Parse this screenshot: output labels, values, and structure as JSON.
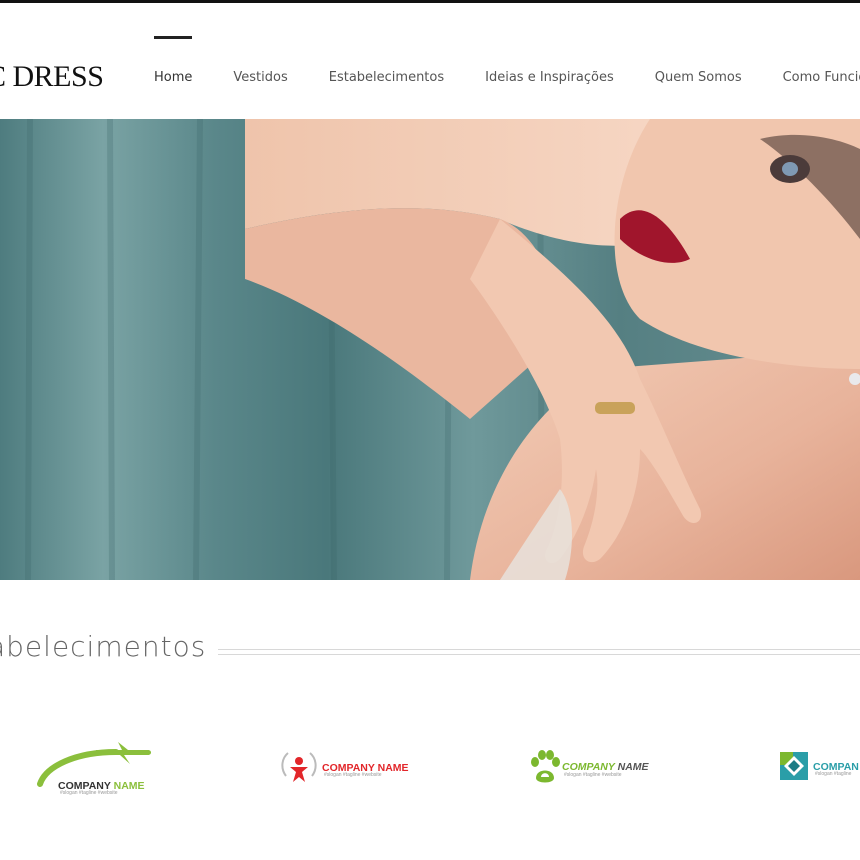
{
  "brand": {
    "logo_text": "C DRESS"
  },
  "nav": {
    "items": [
      {
        "label": "Home",
        "active": true
      },
      {
        "label": "Vestidos"
      },
      {
        "label": "Estabelecimentos"
      },
      {
        "label": "Ideias e Inspirações"
      },
      {
        "label": "Quem Somos"
      },
      {
        "label": "Como Funcior"
      }
    ]
  },
  "section": {
    "title": "abelecimentos"
  },
  "partners": [
    {
      "name_part1": "COMPANY ",
      "name_part2": "NAME",
      "tagline": "#slogan   #tagline   #website",
      "icon": "airplane-icon",
      "color": "#8bbf3c"
    },
    {
      "name_part1": "COMPANY ",
      "name_part2": "NAME",
      "tagline": "#slogan   #tagline   #website",
      "icon": "person-signal-icon",
      "color": "#e2262a"
    },
    {
      "name_part1": "COMPANY ",
      "name_part2": "NAME",
      "tagline": "#slogan   #tagline   #website",
      "icon": "paw-icon",
      "color": "#7cb82f"
    },
    {
      "name_part1": "COMPAN",
      "name_part2": "",
      "tagline": "#slogan   #tagline",
      "icon": "square-diamond-icon",
      "color": "#2a9ea8"
    }
  ],
  "colors": {
    "accent": "#222222",
    "nav_text": "#555555",
    "curtain": "#5f8c8e"
  }
}
